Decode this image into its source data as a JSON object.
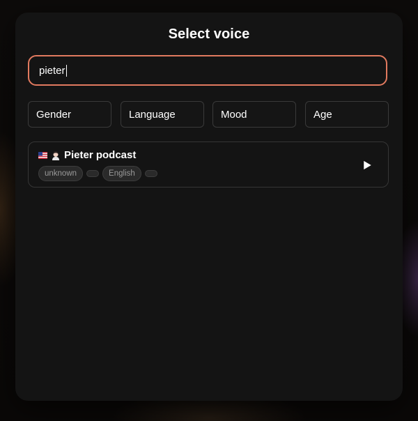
{
  "modal": {
    "title": "Select voice"
  },
  "search": {
    "value": "pieter",
    "accent_color": "#e27a5f"
  },
  "filters": [
    {
      "label": "Gender"
    },
    {
      "label": "Language"
    },
    {
      "label": "Mood"
    },
    {
      "label": "Age"
    }
  ],
  "results": [
    {
      "name": "Pieter podcast",
      "flag_icon": "us-flag-icon",
      "avatar_icon": "person-emoji-icon",
      "tags": [
        "unknown",
        "",
        "English",
        ""
      ],
      "play_icon": "play-icon"
    }
  ]
}
